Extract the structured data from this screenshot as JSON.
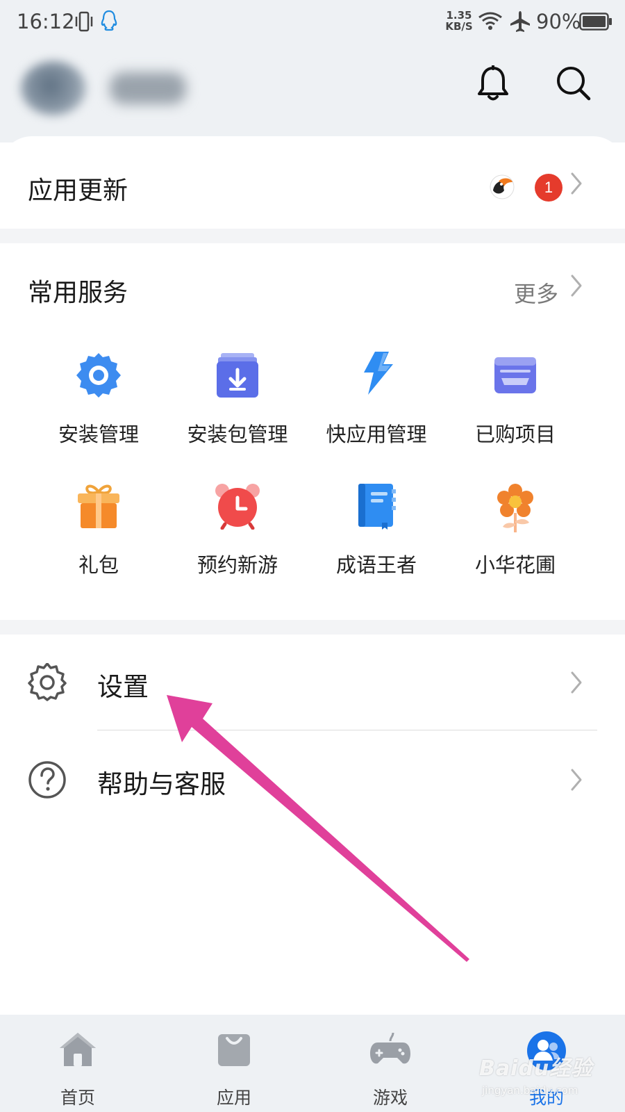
{
  "status_bar": {
    "time": "16:12",
    "net_speed_value": "1.35",
    "net_speed_unit": "KB/S",
    "battery": "90%"
  },
  "header": {
    "icons": [
      "bell-icon",
      "search-icon"
    ]
  },
  "app_update": {
    "title": "应用更新",
    "badge_count": "1"
  },
  "services": {
    "title": "常用服务",
    "more_label": "更多",
    "items": [
      {
        "label": "安装管理",
        "icon": "gear-badge-icon",
        "color": "#3d8cf0"
      },
      {
        "label": "安装包管理",
        "icon": "package-download-icon",
        "color": "#5b6ee8"
      },
      {
        "label": "快应用管理",
        "icon": "lightning-icon",
        "color": "#2f8df2"
      },
      {
        "label": "已购项目",
        "icon": "wallet-icon",
        "color": "#6a74ea"
      },
      {
        "label": "礼包",
        "icon": "gift-icon",
        "color": "#f58a2a"
      },
      {
        "label": "预约新游",
        "icon": "alarm-clock-icon",
        "color": "#f04b4b"
      },
      {
        "label": "成语王者",
        "icon": "book-icon",
        "color": "#2f8df2"
      },
      {
        "label": "小华花圃",
        "icon": "flower-icon",
        "color": "#f0822d"
      }
    ]
  },
  "menu": {
    "settings_label": "设置",
    "help_label": "帮助与客服"
  },
  "bottom_nav": {
    "items": [
      {
        "label": "首页",
        "icon": "home-icon"
      },
      {
        "label": "应用",
        "icon": "bag-icon"
      },
      {
        "label": "游戏",
        "icon": "gamepad-icon"
      },
      {
        "label": "我的",
        "icon": "profile-icon",
        "active": true
      }
    ]
  },
  "watermark": {
    "text": "Baidu经验",
    "sub": "jingyan.baidu.com"
  },
  "colors": {
    "accent": "#1a73e8",
    "badge": "#e53b2c",
    "annotation_arrow": "#e0409a"
  }
}
